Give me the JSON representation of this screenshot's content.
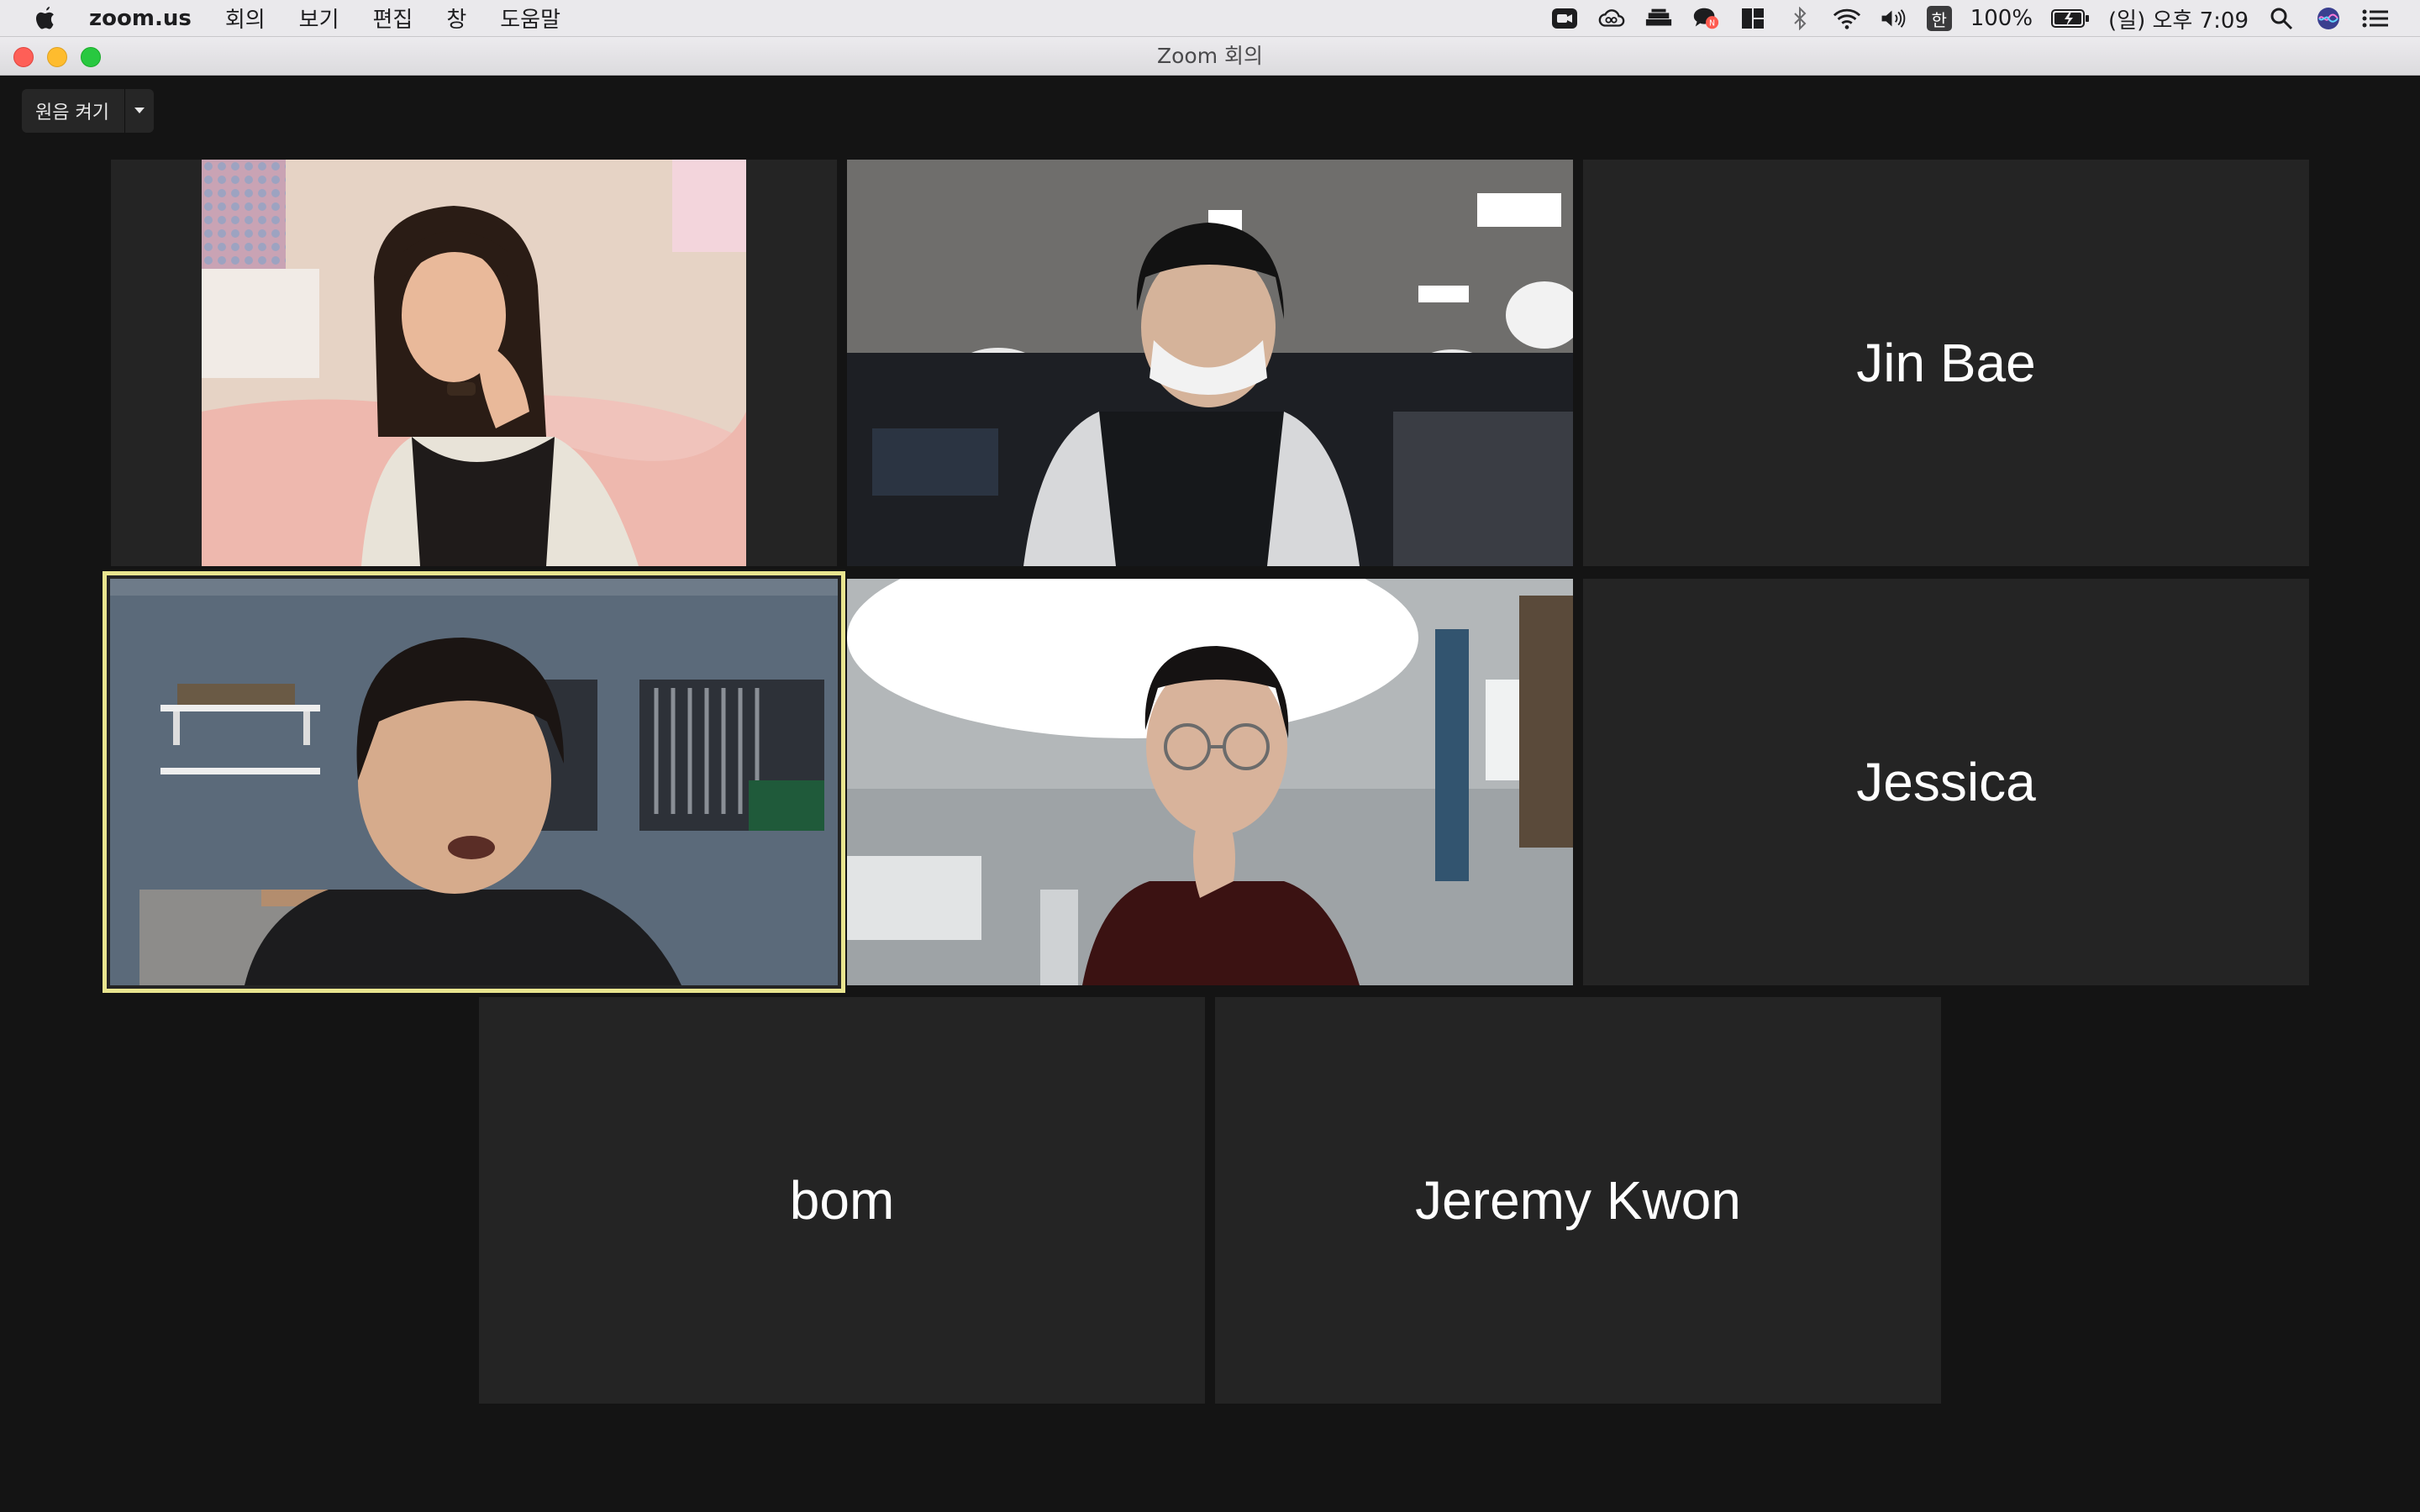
{
  "menubar": {
    "app_name": "zoom.us",
    "menus": [
      "회의",
      "보기",
      "편집",
      "창",
      "도움말"
    ],
    "battery": "100%",
    "clock": "(일) 오후 7:09",
    "input_method": "한",
    "status_icons": [
      "zoom-camera-icon",
      "creative-cloud-icon",
      "stack-icon",
      "chat-notification-icon",
      "layout-icon",
      "bluetooth-icon",
      "wifi-icon",
      "volume-icon",
      "battery-icon",
      "search-icon",
      "siri-icon",
      "control-center-icon"
    ]
  },
  "window": {
    "title": "Zoom 회의"
  },
  "original_sound": {
    "label": "원음 켜기",
    "icon": "chevron-down-icon"
  },
  "participants": [
    {
      "name": "",
      "video": true
    },
    {
      "name": "",
      "video": true
    },
    {
      "name": "Jin Bae",
      "video": false
    },
    {
      "name": "",
      "video": true,
      "active_speaker": true
    },
    {
      "name": "",
      "video": true
    },
    {
      "name": "Jessica",
      "video": false
    },
    {
      "name": "bom",
      "video": false
    },
    {
      "name": "Jeremy Kwon",
      "video": false
    }
  ],
  "colors": {
    "active_speaker_border": "#e9e58f",
    "tile_background": "#242424",
    "window_background": "#141414"
  }
}
